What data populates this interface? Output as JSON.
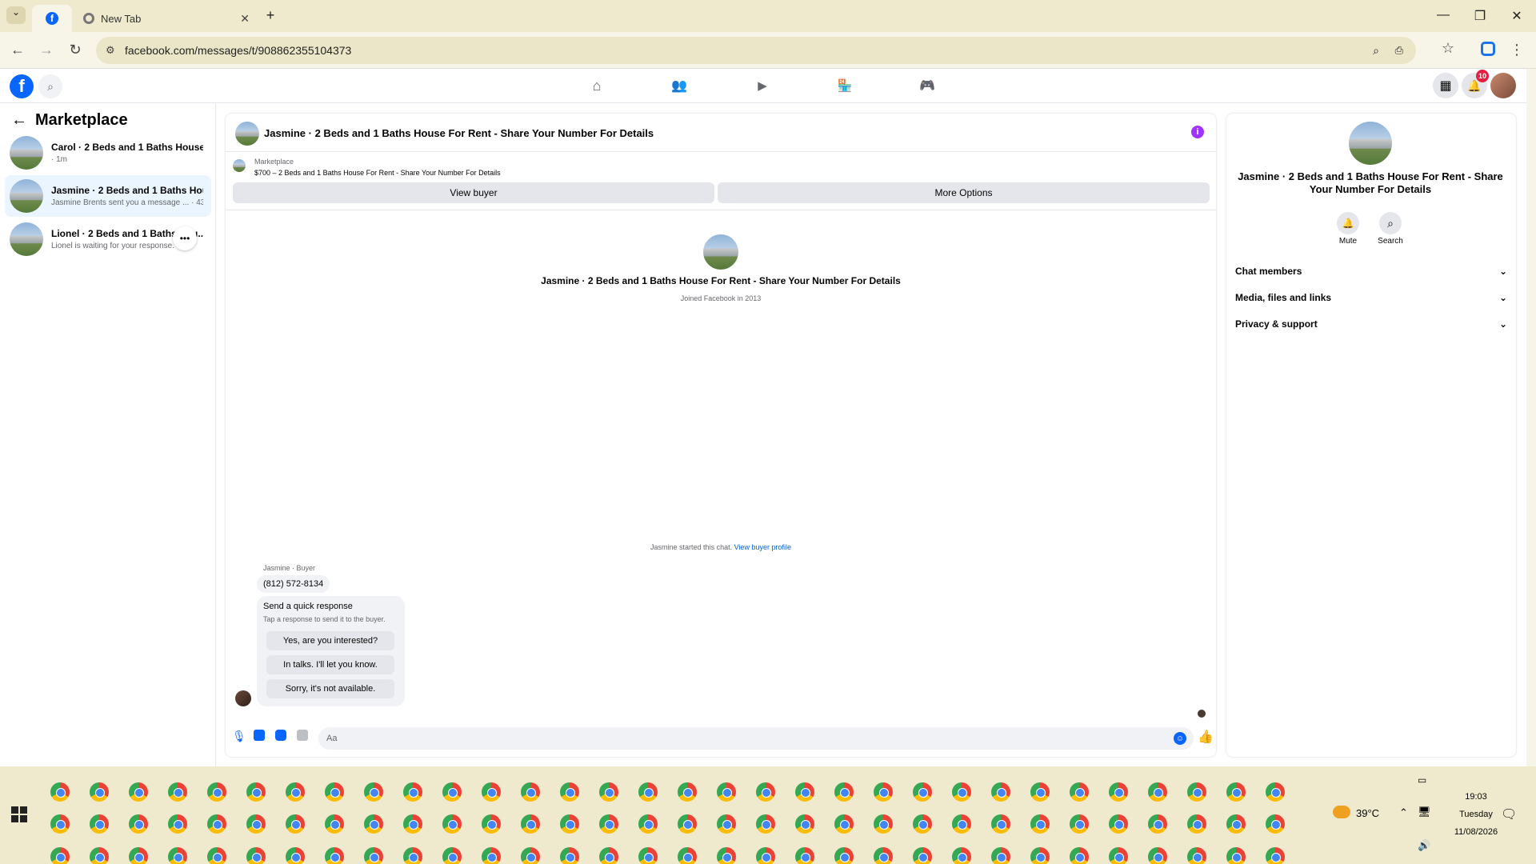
{
  "browser": {
    "active_tab_icon": "facebook-icon",
    "new_tab_label": "New Tab",
    "url": "facebook.com/messages/t/908862355104373"
  },
  "header": {
    "notification_count": "10"
  },
  "sidebar": {
    "title": "Marketplace",
    "conversations": [
      {
        "title": "Carol · 2 Beds and 1 Baths House F...",
        "subtitle": "· 1m"
      },
      {
        "title": "Jasmine · 2 Beds and 1 Baths Hous...",
        "subtitle": "Jasmine Brents sent you a message ...  · 43m"
      },
      {
        "title": "Lionel · 2 Beds and 1 Baths Hou...",
        "subtitle": "Lionel is waiting for your response. · 2..."
      }
    ]
  },
  "chat": {
    "title": "Jasmine · 2 Beds and 1 Baths House For Rent - Share Your Number For Details",
    "listing_source": "Marketplace",
    "listing_text": "$700 – 2 Beds and 1 Baths House For Rent - Share Your Number For Details",
    "view_buyer_label": "View buyer",
    "more_options_label": "More Options",
    "profile_name": "Jasmine · 2 Beds and 1 Baths House For Rent - Share Your Number For Details",
    "joined_text": "Joined Facebook in 2013",
    "started_text": "Jasmine started this chat.",
    "view_profile_link": "View buyer profile",
    "sender_label": "Jasmine · Buyer",
    "message": "(812) 572-8134",
    "quick_title": "Send a quick response",
    "quick_subtitle": "Tap a response to send it to the buyer.",
    "quick_replies": [
      "Yes, are you interested?",
      "In talks. I'll let you know.",
      "Sorry, it's not available."
    ],
    "composer_placeholder": "Aa"
  },
  "details": {
    "title": "Jasmine · 2 Beds and 1 Baths House For Rent - Share Your Number For Details",
    "mute_label": "Mute",
    "search_label": "Search",
    "sections": [
      "Chat members",
      "Media, files and links",
      "Privacy & support"
    ]
  },
  "taskbar": {
    "temperature": "39°C",
    "time": "19:03",
    "day": "Tuesday",
    "date": "11/08/2026"
  },
  "colors": {
    "fb_blue": "#0866ff",
    "link_blue": "#0064d1",
    "info_purple": "#a033ff",
    "browser_chrome": "#efeacd"
  }
}
